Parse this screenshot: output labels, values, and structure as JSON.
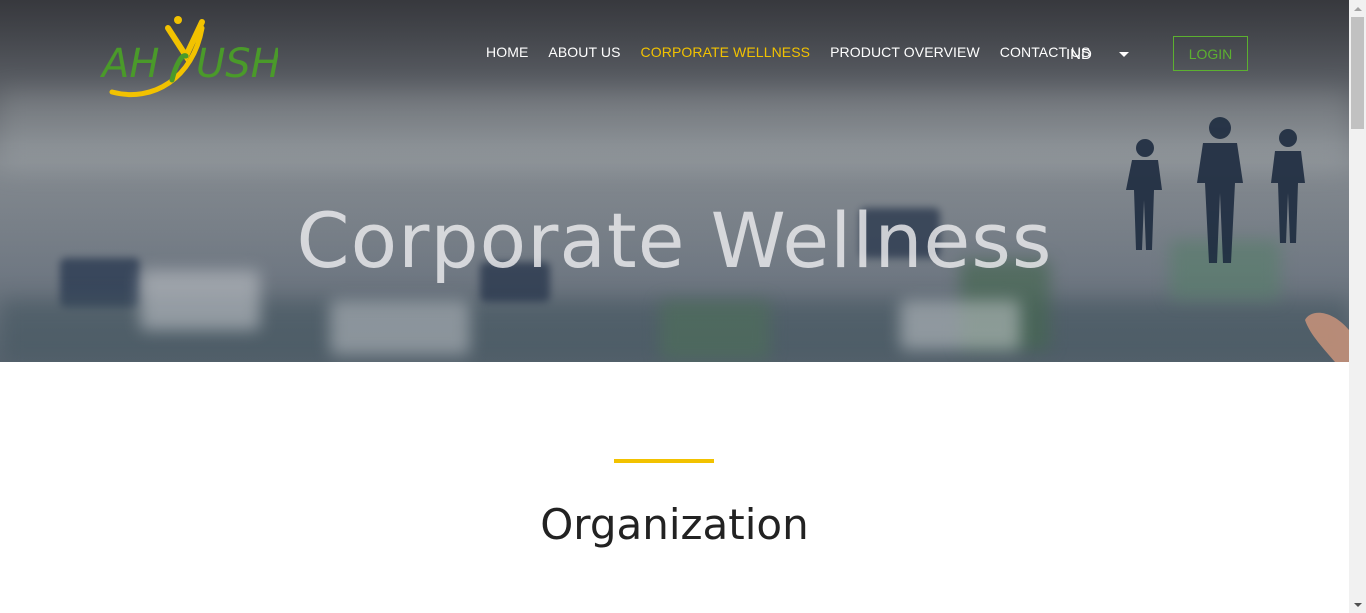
{
  "brand": {
    "name": "AHYUSH",
    "colors": {
      "green": "#4a9a2a",
      "yellow": "#f2c200"
    }
  },
  "nav": {
    "items": [
      {
        "label": "HOME",
        "active": false
      },
      {
        "label": "ABOUT US",
        "active": false
      },
      {
        "label": "CORPORATE WELLNESS",
        "active": true
      },
      {
        "label": "PRODUCT OVERVIEW",
        "active": false
      },
      {
        "label": "CONTACT US",
        "active": false
      }
    ],
    "language": "IND",
    "login_label": "LOGIN"
  },
  "hero": {
    "title": "Corporate Wellness"
  },
  "section": {
    "title": "Organization"
  },
  "colors": {
    "accent": "#f2c200",
    "login_border": "#5cb030",
    "heading_text": "#222222"
  }
}
